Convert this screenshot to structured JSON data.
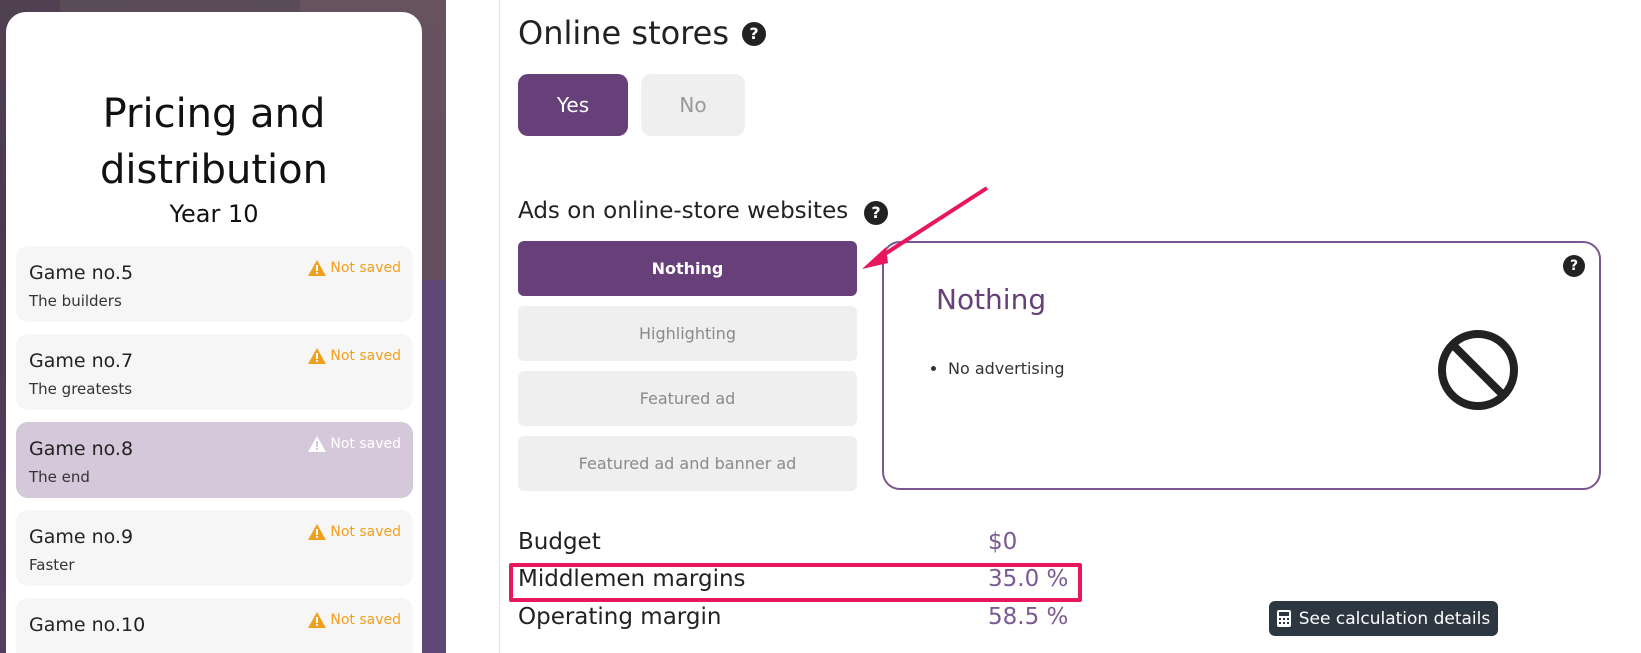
{
  "sidebar": {
    "title": "Pricing and distribution",
    "subtitle": "Year 10",
    "games": [
      {
        "name": "Game no.5",
        "description": "The builders",
        "status": "Not saved",
        "active": false
      },
      {
        "name": "Game no.7",
        "description": "The greatests",
        "status": "Not saved",
        "active": false
      },
      {
        "name": "Game no.8",
        "description": "The end",
        "status": "Not saved",
        "active": true
      },
      {
        "name": "Game no.9",
        "description": "Faster",
        "status": "Not saved",
        "active": false
      },
      {
        "name": "Game no.10",
        "description": "",
        "status": "Not saved",
        "active": false
      }
    ]
  },
  "online_stores": {
    "heading": "Online stores",
    "help_glyph": "?",
    "yes_label": "Yes",
    "no_label": "No",
    "selected": "Yes"
  },
  "ads": {
    "heading": "Ads on online-store websites",
    "help_glyph": "?",
    "options": [
      "Nothing",
      "Highlighting",
      "Featured ad",
      "Featured ad and banner ad"
    ],
    "selected": "Nothing",
    "detail": {
      "title": "Nothing",
      "bullets": [
        "No advertising"
      ],
      "help_glyph": "?",
      "icon": "no-entry-icon"
    }
  },
  "summary": {
    "budget_label": "Budget",
    "budget_value": "$0",
    "middlemen_label": "Middlemen margins",
    "middlemen_value": "35.0 %",
    "operating_label": "Operating margin",
    "operating_value": "58.5 %"
  },
  "calc_button": {
    "label": "See calculation details",
    "icon": "calculator-icon"
  },
  "colors": {
    "accent": "#674079",
    "highlight": "#e8175d",
    "warning": "#f0a01c",
    "dark_button": "#2d3742"
  }
}
